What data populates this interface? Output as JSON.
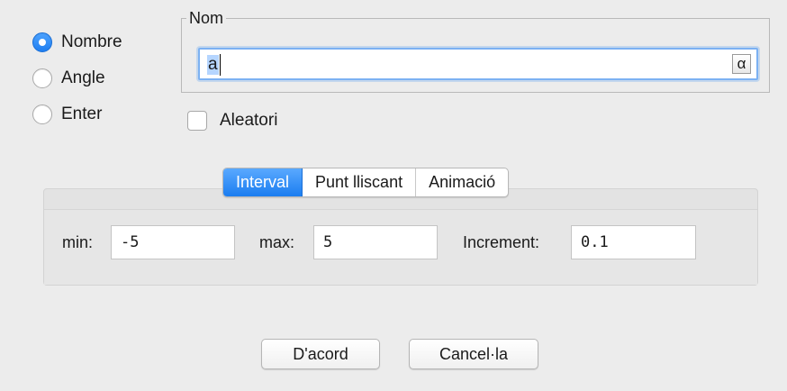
{
  "type_options": [
    {
      "label": "Nombre",
      "checked": true
    },
    {
      "label": "Angle",
      "checked": false
    },
    {
      "label": "Enter",
      "checked": false
    }
  ],
  "name_group": {
    "legend": "Nom",
    "value": "a",
    "symbol_button": "α"
  },
  "random_checkbox": {
    "label": "Aleatori",
    "checked": false
  },
  "tabs": [
    {
      "label": "Interval",
      "active": true
    },
    {
      "label": "Punt lliscant",
      "active": false
    },
    {
      "label": "Animació",
      "active": false
    }
  ],
  "interval": {
    "min_label": "min:",
    "min_value": "-5",
    "max_label": "max:",
    "max_value": "5",
    "increment_label": "Increment:",
    "increment_value": "0.1"
  },
  "buttons": {
    "ok": "D'acord",
    "cancel": "Cancel·la"
  },
  "colors": {
    "accent": "#1f7ef0",
    "background": "#ececec",
    "selection": "#b5d5ff"
  }
}
